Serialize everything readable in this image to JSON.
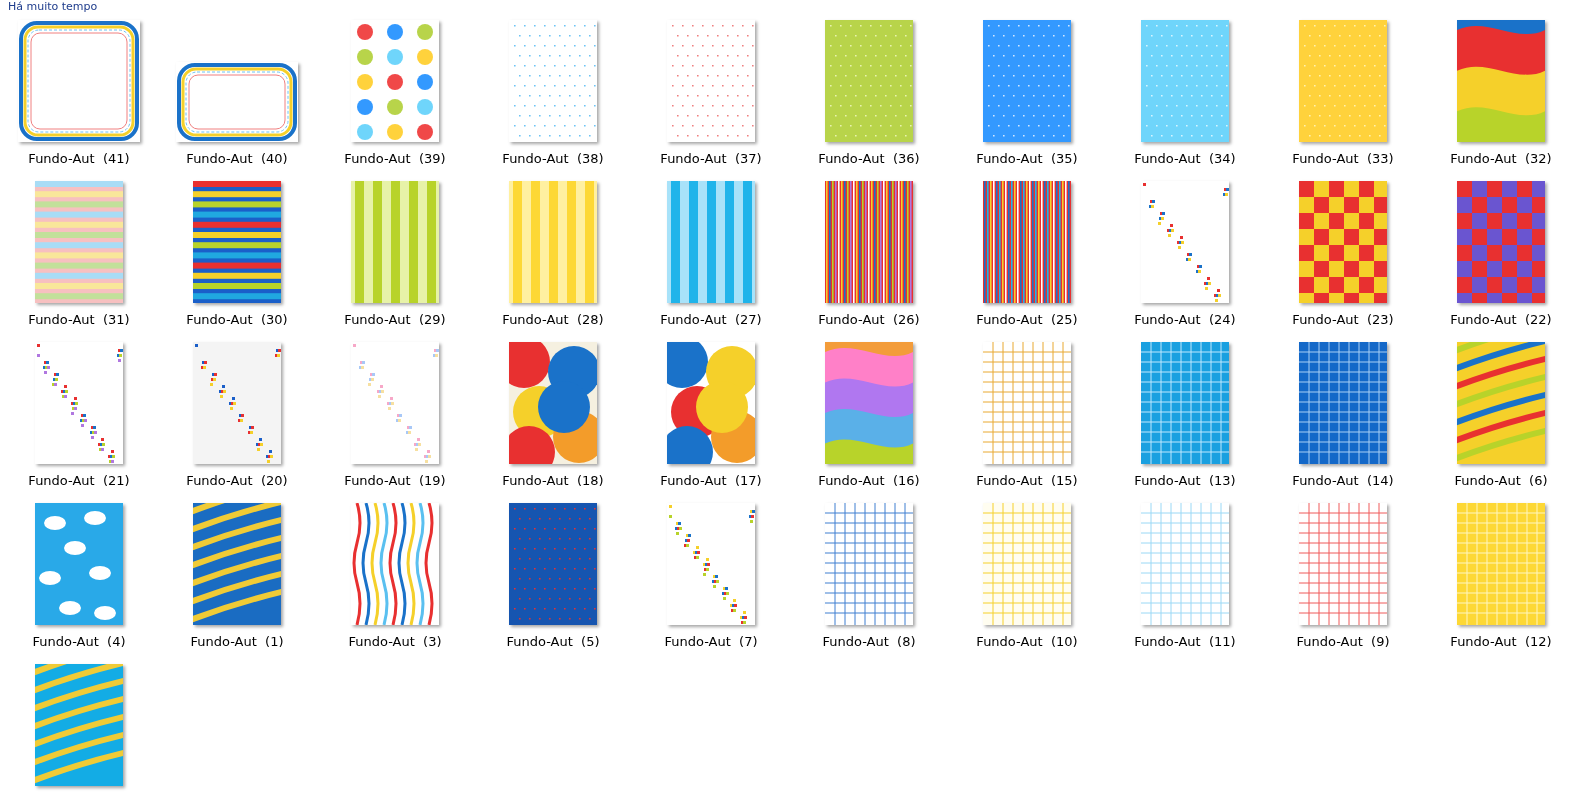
{
  "group_header": "Há muito tempo",
  "files": [
    {
      "label": "Fundo-Aut  (41)",
      "kind": "picture"
    },
    {
      "label": "Fundo-Aut  (40)",
      "kind": "picture"
    },
    {
      "label": "Fundo-Aut  (39)",
      "kind": "picture"
    },
    {
      "label": "Fundo-Aut  (38)",
      "kind": "picture"
    },
    {
      "label": "Fundo-Aut  (37)",
      "kind": "picture"
    },
    {
      "label": "Fundo-Aut  (36)",
      "kind": "picture"
    },
    {
      "label": "Fundo-Aut  (35)",
      "kind": "picture"
    },
    {
      "label": "Fundo-Aut  (34)",
      "kind": "picture"
    },
    {
      "label": "Fundo-Aut  (33)",
      "kind": "picture"
    },
    {
      "label": "Fundo-Aut  (32)",
      "kind": "picture"
    },
    {
      "label": "Fundo-Aut  (31)",
      "kind": "picture"
    },
    {
      "label": "Fundo-Aut  (30)",
      "kind": "picture"
    },
    {
      "label": "Fundo-Aut  (29)",
      "kind": "picture"
    },
    {
      "label": "Fundo-Aut  (28)",
      "kind": "picture"
    },
    {
      "label": "Fundo-Aut  (27)",
      "kind": "picture"
    },
    {
      "label": "Fundo-Aut  (26)",
      "kind": "picture"
    },
    {
      "label": "Fundo-Aut  (25)",
      "kind": "picture"
    },
    {
      "label": "Fundo-Aut  (24)",
      "kind": "picture"
    },
    {
      "label": "Fundo-Aut  (23)",
      "kind": "picture"
    },
    {
      "label": "Fundo-Aut  (22)",
      "kind": "picture"
    },
    {
      "label": "Fundo-Aut  (21)",
      "kind": "picture"
    },
    {
      "label": "Fundo-Aut  (20)",
      "kind": "picture"
    },
    {
      "label": "Fundo-Aut  (19)",
      "kind": "picture"
    },
    {
      "label": "Fundo-Aut  (18)",
      "kind": "picture"
    },
    {
      "label": "Fundo-Aut  (17)",
      "kind": "picture"
    },
    {
      "label": "Fundo-Aut  (16)",
      "kind": "picture"
    },
    {
      "label": "Fundo-Aut  (15)",
      "kind": "picture"
    },
    {
      "label": "Fundo-Aut  (13)",
      "kind": "picture"
    },
    {
      "label": "Fundo-Aut  (14)",
      "kind": "picture"
    },
    {
      "label": "Fundo-Aut  (6)",
      "kind": "picture"
    },
    {
      "label": "Fundo-Aut  (4)",
      "kind": "picture"
    },
    {
      "label": "Fundo-Aut  (1)",
      "kind": "picture"
    },
    {
      "label": "Fundo-Aut  (3)",
      "kind": "picture"
    },
    {
      "label": "Fundo-Aut  (5)",
      "kind": "picture"
    },
    {
      "label": "Fundo-Aut  (7)",
      "kind": "picture"
    },
    {
      "label": "Fundo-Aut  (8)",
      "kind": "picture"
    },
    {
      "label": "Fundo-Aut  (10)",
      "kind": "picture"
    },
    {
      "label": "Fundo-Aut  (11)",
      "kind": "picture"
    },
    {
      "label": "Fundo-Aut  (9)",
      "kind": "picture"
    },
    {
      "label": "Fundo-Aut  (12)",
      "kind": "picture"
    },
    {
      "kind": "picture"
    }
  ]
}
